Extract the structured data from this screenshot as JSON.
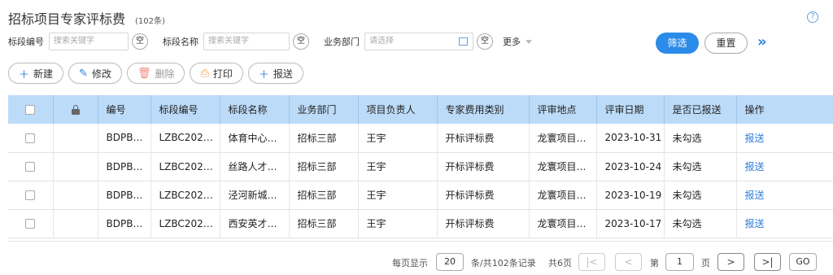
{
  "header": {
    "title": "招标项目专家评标费",
    "count": "(102条)",
    "help": "?"
  },
  "filters": {
    "f1_label": "标段编号",
    "f1_placeholder": "搜索关键字",
    "f2_label": "标段名称",
    "f2_placeholder": "搜索关键字",
    "f3_label": "业务部门",
    "f3_placeholder": "请选择",
    "empty_label": "空",
    "more_label": "更多",
    "search_label": "筛选",
    "reset_label": "重置",
    "expand_label": "»"
  },
  "toolbar": {
    "new_label": "新建",
    "edit_label": "修改",
    "delete_label": "删除",
    "print_label": "打印",
    "submit_label": "报送",
    "new_icon": "plus-icon",
    "edit_icon": "pencil-icon",
    "delete_icon": "trash-icon",
    "print_icon": "printer-icon",
    "submit_icon": "plus-icon"
  },
  "table": {
    "columns": [
      "编号",
      "标段编号",
      "标段名称",
      "业务部门",
      "项目负责人",
      "专家费用类别",
      "评审地点",
      "评审日期",
      "是否已报送",
      "操作"
    ],
    "rows": [
      {
        "id": "BDPB…",
        "code": "LZBC202…",
        "name": "体育中心…",
        "dept": "招标三部",
        "owner": "王宇",
        "fee_type": "开标评标费",
        "place": "龙寰项目…",
        "date": "2023-10-31",
        "submitted": "未勾选",
        "action": "报送"
      },
      {
        "id": "BDPB…",
        "code": "LZBC202…",
        "name": "丝路人才…",
        "dept": "招标三部",
        "owner": "王宇",
        "fee_type": "开标评标费",
        "place": "龙寰项目…",
        "date": "2023-10-24",
        "submitted": "未勾选",
        "action": "报送"
      },
      {
        "id": "BDPB…",
        "code": "LZBC202…",
        "name": "泾河新城…",
        "dept": "招标三部",
        "owner": "王宇",
        "fee_type": "开标评标费",
        "place": "龙寰项目…",
        "date": "2023-10-19",
        "submitted": "未勾选",
        "action": "报送"
      },
      {
        "id": "BDPB…",
        "code": "LZBC202…",
        "name": "西安英才…",
        "dept": "招标三部",
        "owner": "王宇",
        "fee_type": "开标评标费",
        "place": "龙寰项目…",
        "date": "2023-10-17",
        "submitted": "未勾选",
        "action": "报送"
      }
    ]
  },
  "pager": {
    "per_page_prefix": "每页显示",
    "per_page": "20",
    "total_text": "条/共102条记录",
    "pages_text": "共6页",
    "page_prefix": "第",
    "page": "1",
    "page_suffix": "页",
    "go_label": "GO"
  },
  "colors": {
    "accent": "#2b8be8",
    "header_bg": "#bcdbf8",
    "link": "#2b7ede"
  }
}
